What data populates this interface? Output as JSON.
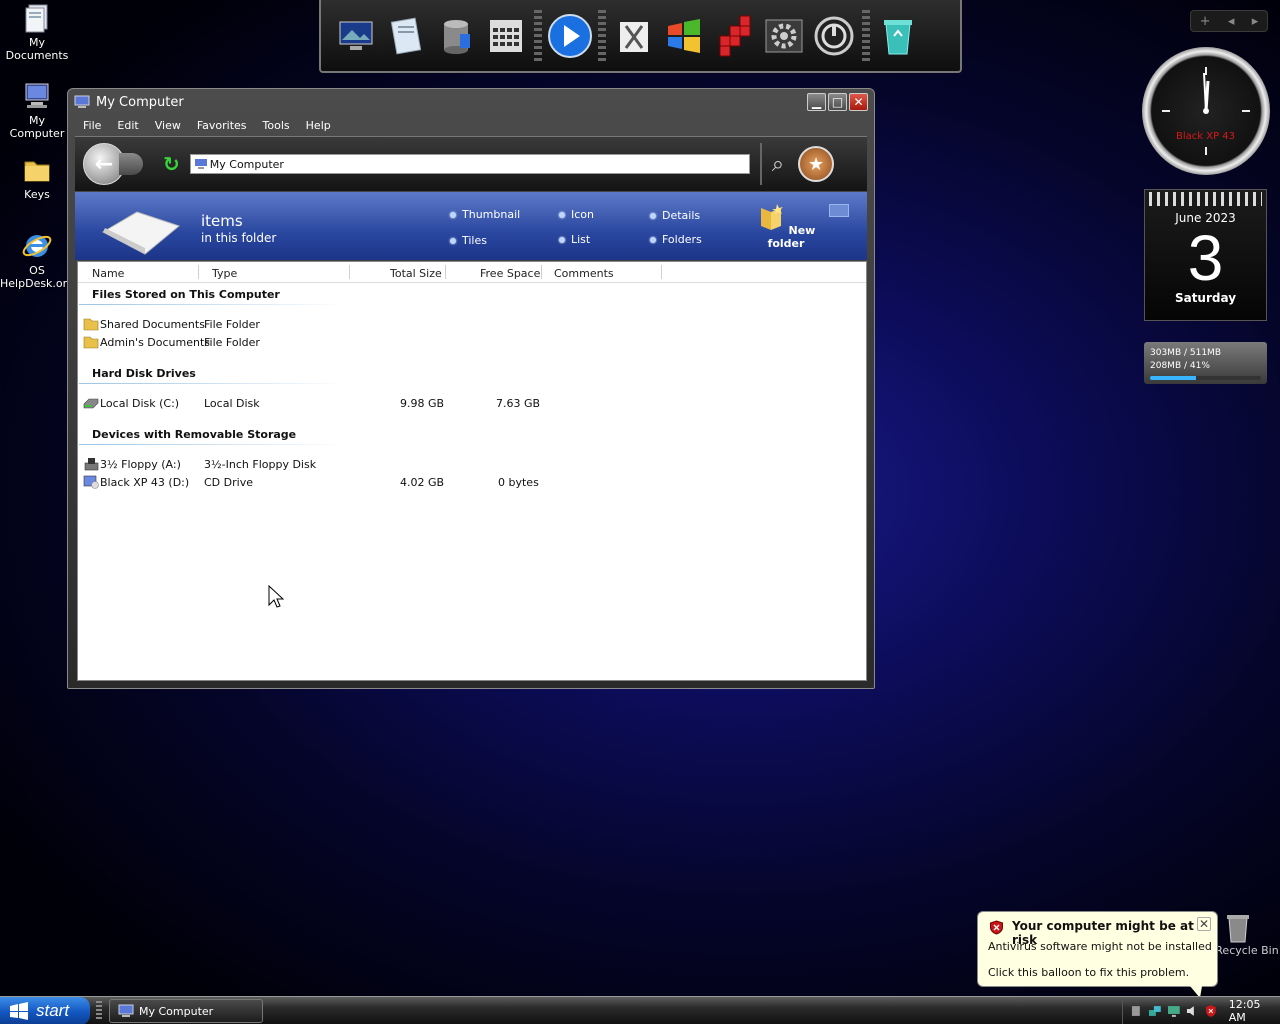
{
  "desktop_icons": [
    {
      "label": "My Documents"
    },
    {
      "label": "My Computer"
    },
    {
      "label": "Keys"
    },
    {
      "label": "OS HelpDesk.org"
    }
  ],
  "recycle_bin": {
    "label": "Recycle Bin"
  },
  "calendar": {
    "month_year": "June 2023",
    "day": "3",
    "weekday": "Saturday"
  },
  "clock": {
    "brand": "Black XP 43",
    "time": "12:05"
  },
  "memory": {
    "line1": "303MB / 511MB",
    "line2": "208MB / 41%",
    "usage_fraction": 0.41
  },
  "window": {
    "title": "My Computer",
    "menu": [
      "File",
      "Edit",
      "View",
      "Favorites",
      "Tools",
      "Help"
    ],
    "address": "My Computer",
    "info": {
      "items_label": "items",
      "sub_label": "in this folder",
      "views": [
        "Thumbnail",
        "Icon",
        "Details",
        "Tiles",
        "List",
        "Folders"
      ],
      "new_folder": "New folder"
    },
    "columns": [
      "Name",
      "Type",
      "Total Size",
      "Free Space",
      "Comments"
    ],
    "groups": [
      {
        "title": "Files Stored on This Computer",
        "rows": [
          {
            "name": "Shared Documents",
            "type": "File Folder",
            "total": "",
            "free": "",
            "icon": "folder-icon"
          },
          {
            "name": "Admin's Documents",
            "type": "File Folder",
            "total": "",
            "free": "",
            "icon": "folder-icon"
          }
        ]
      },
      {
        "title": "Hard Disk Drives",
        "rows": [
          {
            "name": "Local Disk (C:)",
            "type": "Local Disk",
            "total": "9.98 GB",
            "free": "7.63 GB",
            "icon": "hard-disk-icon"
          }
        ]
      },
      {
        "title": "Devices with Removable Storage",
        "rows": [
          {
            "name": "3½ Floppy (A:)",
            "type": "3½-Inch Floppy Disk",
            "total": "",
            "free": "",
            "icon": "floppy-drive-icon"
          },
          {
            "name": "Black XP 43 (D:)",
            "type": "CD Drive",
            "total": "4.02 GB",
            "free": "0 bytes",
            "icon": "cd-drive-icon"
          }
        ]
      }
    ]
  },
  "balloon": {
    "title": "Your computer might be at risk",
    "line1": "Antivirus software might not be installed",
    "line2": "Click this balloon to fix this problem."
  },
  "taskbar": {
    "start_label": "start",
    "task_label": "My Computer",
    "time": "12:05 AM"
  },
  "colors": {
    "info_bar": "#2a47a0",
    "start": "#1256c0",
    "balloon": "#ffffe1"
  }
}
